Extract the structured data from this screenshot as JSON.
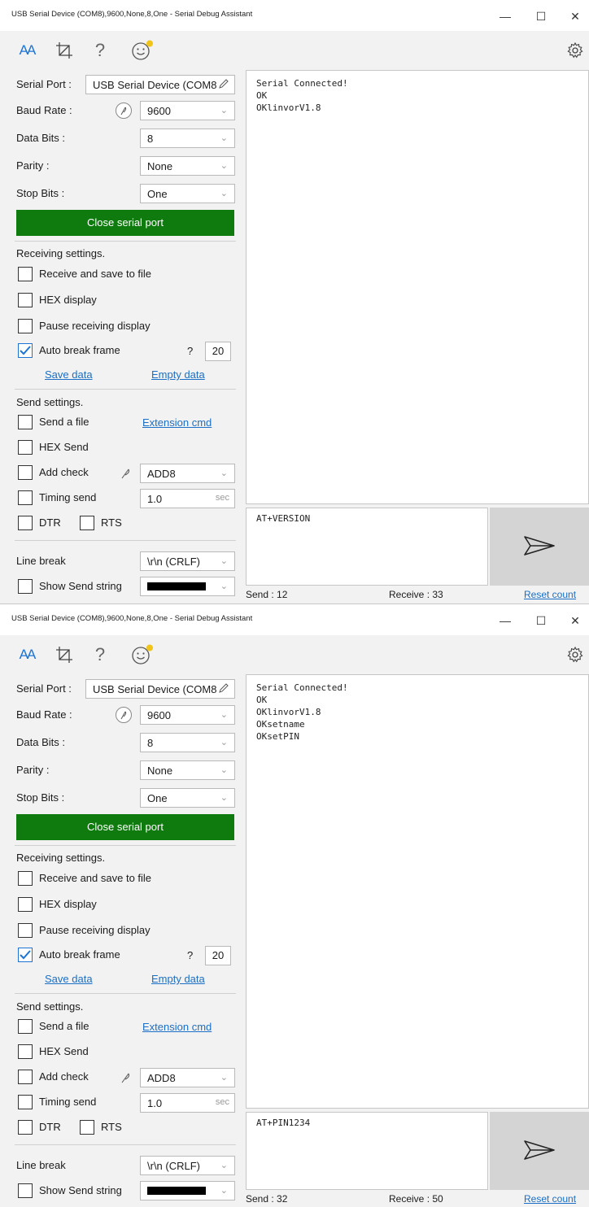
{
  "windows": [
    {
      "title": "USB Serial Device (COM8),9600,None,8,One - Serial Debug Assistant",
      "toolbar": {
        "font_icon_text": "AA"
      },
      "port": {
        "serial_port_label": "Serial Port :",
        "serial_port_value": "USB Serial Device (COM8",
        "baud_label": "Baud Rate :",
        "baud_value": "9600",
        "data_bits_label": "Data Bits :",
        "data_bits_value": "8",
        "parity_label": "Parity :",
        "parity_value": "None",
        "stop_bits_label": "Stop Bits :",
        "stop_bits_value": "One",
        "close_button": "Close serial port"
      },
      "receiving": {
        "heading": "Receiving settings.",
        "save_to_file": "Receive and save to file",
        "save_to_file_checked": false,
        "hex_display": "HEX display",
        "hex_display_checked": false,
        "pause": "Pause receiving display",
        "pause_checked": false,
        "auto_break": "Auto break frame",
        "auto_break_checked": true,
        "auto_break_help": "?",
        "auto_break_value": "20",
        "save_data": "Save data",
        "empty_data": "Empty data"
      },
      "sending": {
        "heading": "Send settings.",
        "send_file": "Send a file",
        "extension_cmd": "Extension cmd",
        "hex_send": "HEX Send",
        "add_check": "Add check",
        "add_check_value": "ADD8",
        "timing_send": "Timing send",
        "timing_value": "1.0",
        "timing_unit": "sec",
        "dtr": "DTR",
        "rts": "RTS",
        "line_break_label": "Line break",
        "line_break_value": "\\r\\n (CRLF)",
        "show_send_string": "Show Send string"
      },
      "receive_lines": [
        "Serial Connected!",
        "OK",
        "OKlinvorV1.8"
      ],
      "send_text": "AT+VERSION",
      "status": {
        "send": "Send : 12",
        "receive": "Receive : 33",
        "reset": "Reset count"
      }
    },
    {
      "title": "USB Serial Device (COM8),9600,None,8,One - Serial Debug Assistant",
      "toolbar": {
        "font_icon_text": "AA"
      },
      "port": {
        "serial_port_label": "Serial Port :",
        "serial_port_value": "USB Serial Device (COM8",
        "baud_label": "Baud Rate :",
        "baud_value": "9600",
        "data_bits_label": "Data Bits :",
        "data_bits_value": "8",
        "parity_label": "Parity :",
        "parity_value": "None",
        "stop_bits_label": "Stop Bits :",
        "stop_bits_value": "One",
        "close_button": "Close serial port"
      },
      "receiving": {
        "heading": "Receiving settings.",
        "save_to_file": "Receive and save to file",
        "save_to_file_checked": false,
        "hex_display": "HEX display",
        "hex_display_checked": false,
        "pause": "Pause receiving display",
        "pause_checked": false,
        "auto_break": "Auto break frame",
        "auto_break_checked": true,
        "auto_break_help": "?",
        "auto_break_value": "20",
        "save_data": "Save data",
        "empty_data": "Empty data"
      },
      "sending": {
        "heading": "Send settings.",
        "send_file": "Send a file",
        "extension_cmd": "Extension cmd",
        "hex_send": "HEX Send",
        "add_check": "Add check",
        "add_check_value": "ADD8",
        "timing_send": "Timing send",
        "timing_value": "1.0",
        "timing_unit": "sec",
        "dtr": "DTR",
        "rts": "RTS",
        "line_break_label": "Line break",
        "line_break_value": "\\r\\n (CRLF)",
        "show_send_string": "Show Send string"
      },
      "receive_lines": [
        "Serial Connected!",
        "OK",
        "OKlinvorV1.8",
        "OKsetname",
        "OKsetPIN"
      ],
      "send_text": "AT+PIN1234",
      "status": {
        "send": "Send : 32",
        "receive": "Receive : 50",
        "reset": "Reset count"
      }
    }
  ],
  "colors": {
    "accent_green": "#0f7b0f",
    "link_blue": "#1b6fc7",
    "check_blue": "#1d74d4",
    "send_button_bg": "#d4d4d4"
  },
  "icons": [
    "font-size-icon",
    "crop-icon",
    "help-icon",
    "smiley-icon",
    "settings-gear-icon",
    "pencil-icon",
    "feather-icon",
    "send-arrow-icon"
  ]
}
